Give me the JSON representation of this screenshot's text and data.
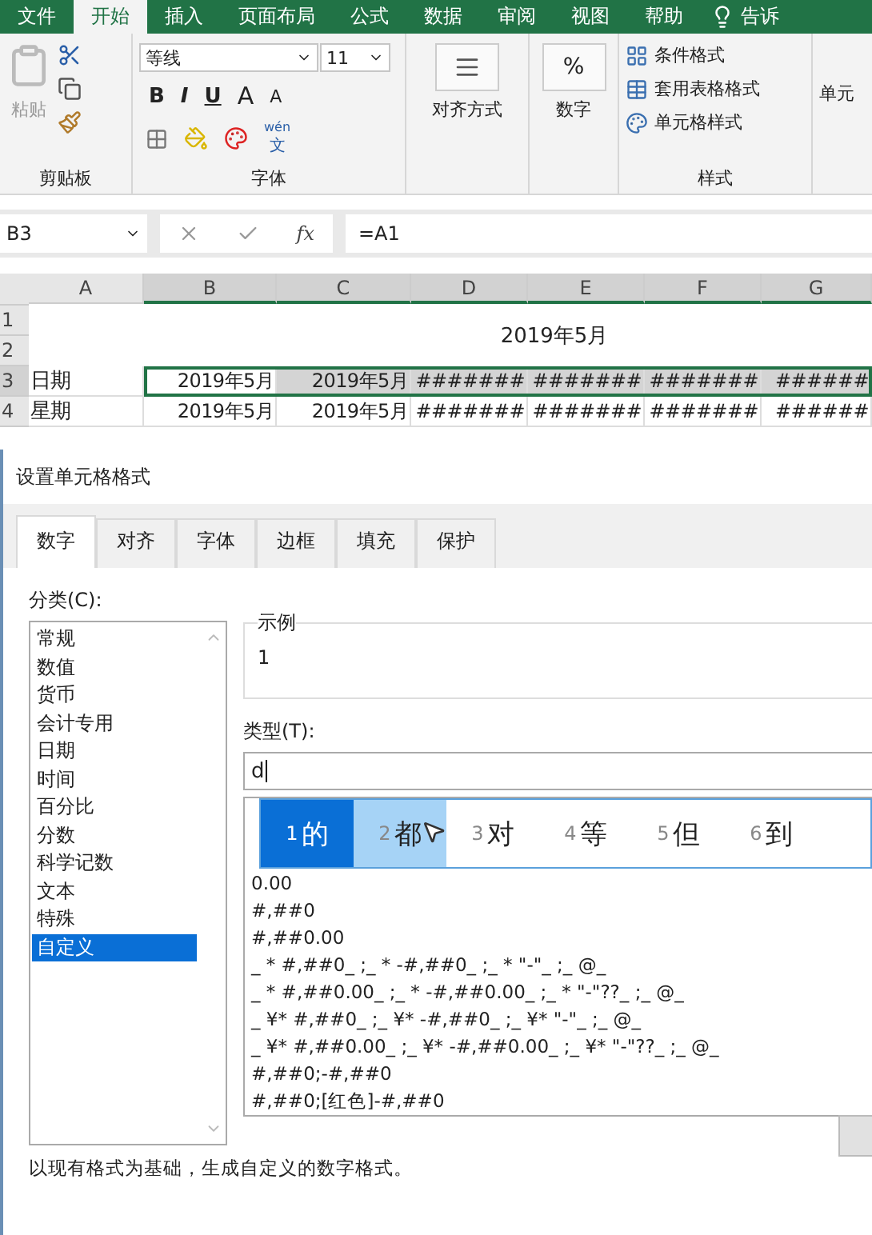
{
  "ribbon_tabs": [
    {
      "label": "文件",
      "selected": false
    },
    {
      "label": "开始",
      "selected": true
    },
    {
      "label": "插入",
      "selected": false
    },
    {
      "label": "页面布局",
      "selected": false
    },
    {
      "label": "公式",
      "selected": false
    },
    {
      "label": "数据",
      "selected": false
    },
    {
      "label": "审阅",
      "selected": false
    },
    {
      "label": "视图",
      "selected": false
    },
    {
      "label": "帮助",
      "selected": false
    }
  ],
  "tell_me": "告诉",
  "clipboard": {
    "paste": "粘贴",
    "group": "剪贴板"
  },
  "font": {
    "name": "等线",
    "size": "11",
    "bold": "B",
    "italic": "I",
    "underline": "U",
    "grow": "A",
    "shrink": "A",
    "phonetic": "wén",
    "phonetic_char": "文",
    "group": "字体"
  },
  "alignment": {
    "label": "对齐方式"
  },
  "number": {
    "symbol": "%",
    "label": "数字"
  },
  "styles": {
    "items": [
      "条件格式",
      "套用表格格式",
      "单元格样式"
    ],
    "group": "样式"
  },
  "cells": {
    "label": "单元"
  },
  "formula_bar": {
    "name_box": "B3",
    "function": "fx",
    "formula": "=A1"
  },
  "sheet": {
    "columns": [
      {
        "label": "A",
        "selected": false
      },
      {
        "label": "B",
        "selected": true
      },
      {
        "label": "C",
        "selected": true
      },
      {
        "label": "D",
        "selected": true
      },
      {
        "label": "E",
        "selected": true
      },
      {
        "label": "F",
        "selected": true
      },
      {
        "label": "G",
        "selected": true
      }
    ],
    "title_rows": [
      "1",
      "2"
    ],
    "title": "2019年5月",
    "rows": [
      {
        "header": "3",
        "selected": true,
        "cells": [
          {
            "text": "日期",
            "selected": false
          },
          {
            "text": "2019年5月",
            "selected": false
          },
          {
            "text": "2019年5月",
            "selected": true
          },
          {
            "text": "#######",
            "selected": true
          },
          {
            "text": "#######",
            "selected": true
          },
          {
            "text": "#######",
            "selected": true
          },
          {
            "text": "######",
            "selected": true
          }
        ]
      },
      {
        "header": "4",
        "selected": false,
        "cells": [
          {
            "text": "星期",
            "selected": false
          },
          {
            "text": "2019年5月",
            "selected": false
          },
          {
            "text": "2019年5月",
            "selected": false
          },
          {
            "text": "#######",
            "selected": false
          },
          {
            "text": "#######",
            "selected": false
          },
          {
            "text": "#######",
            "selected": false
          },
          {
            "text": "######",
            "selected": false
          }
        ]
      }
    ]
  },
  "dialog": {
    "title": "设置单元格格式",
    "tabs": [
      {
        "label": "数字",
        "selected": true
      },
      {
        "label": "对齐",
        "selected": false
      },
      {
        "label": "字体",
        "selected": false
      },
      {
        "label": "边框",
        "selected": false
      },
      {
        "label": "填充",
        "selected": false
      },
      {
        "label": "保护",
        "selected": false
      }
    ],
    "category_label": "分类(C):",
    "categories": [
      {
        "label": "常规",
        "selected": false
      },
      {
        "label": "数值",
        "selected": false
      },
      {
        "label": "货币",
        "selected": false
      },
      {
        "label": "会计专用",
        "selected": false
      },
      {
        "label": "日期",
        "selected": false
      },
      {
        "label": "时间",
        "selected": false
      },
      {
        "label": "百分比",
        "selected": false
      },
      {
        "label": "分数",
        "selected": false
      },
      {
        "label": "科学记数",
        "selected": false
      },
      {
        "label": "文本",
        "selected": false
      },
      {
        "label": "特殊",
        "selected": false
      },
      {
        "label": "自定义",
        "selected": true
      }
    ],
    "sample_label": "示例",
    "sample": "1",
    "type_label": "类型(T):",
    "type_value": "d",
    "ime_candidates": [
      {
        "index": "1",
        "char": "的",
        "selected": true,
        "hovered": false
      },
      {
        "index": "2",
        "char": "都",
        "selected": false,
        "hovered": true
      },
      {
        "index": "3",
        "char": "对",
        "selected": false,
        "hovered": false
      },
      {
        "index": "4",
        "char": "等",
        "selected": false,
        "hovered": false
      },
      {
        "index": "5",
        "char": "但",
        "selected": false,
        "hovered": false
      },
      {
        "index": "6",
        "char": "到",
        "selected": false,
        "hovered": false
      }
    ],
    "formats": [
      "0.00",
      "#,##0",
      "#,##0.00",
      "_ * #,##0_ ;_ * -#,##0_ ;_ * \"-\"_ ;_ @_",
      "_ * #,##0.00_ ;_ * -#,##0.00_ ;_ * \"-\"??_ ;_ @_",
      "_ ¥* #,##0_ ;_ ¥* -#,##0_ ;_ ¥* \"-\"_ ;_ @_",
      "_ ¥* #,##0.00_ ;_ ¥* -#,##0.00_ ;_ ¥* \"-\"??_ ;_ @_",
      "#,##0;-#,##0",
      "#,##0;[红色]-#,##0"
    ],
    "description": "以现有格式为基础，生成自定义的数字格式。"
  }
}
